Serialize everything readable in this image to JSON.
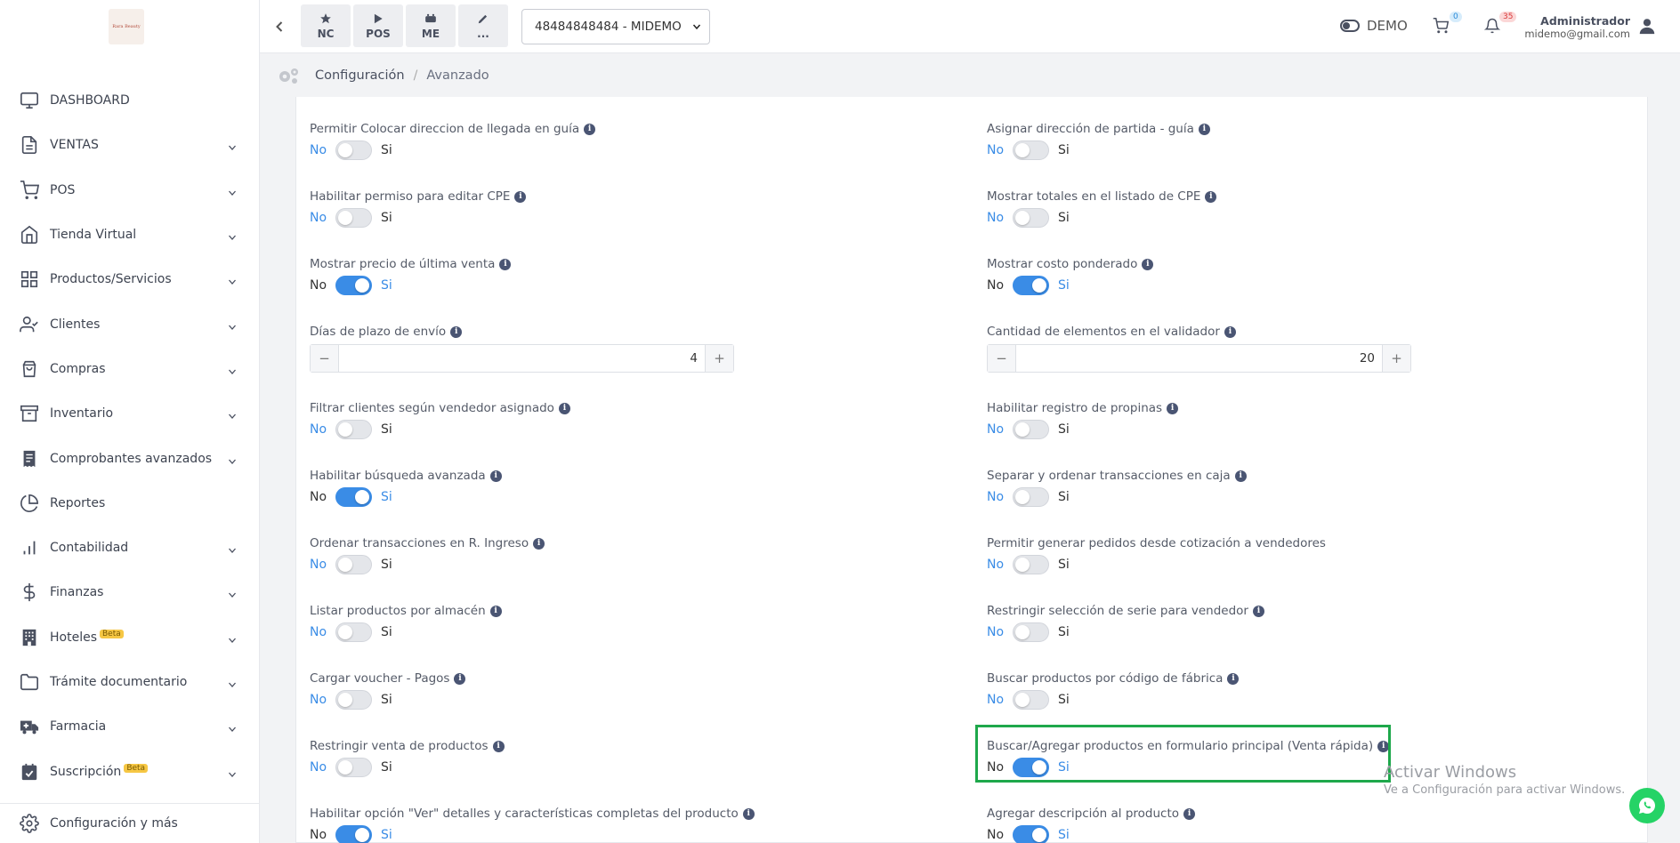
{
  "sidebar": {
    "logo_text": "Rara Beauty",
    "items": [
      {
        "label": "DASHBOARD",
        "icon": "monitor-icon",
        "chevron": false
      },
      {
        "label": "VENTAS",
        "icon": "document-icon",
        "chevron": true
      },
      {
        "label": "POS",
        "icon": "cart-icon",
        "chevron": true
      },
      {
        "label": "Tienda Virtual",
        "icon": "home-icon",
        "chevron": true
      },
      {
        "label": "Productos/Servicios",
        "icon": "grid-icon",
        "chevron": true
      },
      {
        "label": "Clientes",
        "icon": "user-check-icon",
        "chevron": true
      },
      {
        "label": "Compras",
        "icon": "bag-icon",
        "chevron": true
      },
      {
        "label": "Inventario",
        "icon": "archive-icon",
        "chevron": true
      },
      {
        "label": "Comprobantes avanzados",
        "icon": "receipt-icon",
        "chevron": true
      },
      {
        "label": "Reportes",
        "icon": "pie-chart-icon",
        "chevron": false
      },
      {
        "label": "Contabilidad",
        "icon": "bar-chart-icon",
        "chevron": true
      },
      {
        "label": "Finanzas",
        "icon": "dollar-icon",
        "chevron": true
      },
      {
        "label": "Hoteles",
        "icon": "building-icon",
        "chevron": true,
        "badge": "Beta"
      },
      {
        "label": "Trámite documentario",
        "icon": "folder-icon",
        "chevron": true
      },
      {
        "label": "Farmacia",
        "icon": "truck-medical-icon",
        "chevron": true
      },
      {
        "label": "Suscripción",
        "icon": "calendar-check-icon",
        "chevron": true,
        "badge": "Beta"
      }
    ],
    "footer_label": "Configuración y más"
  },
  "topbar": {
    "buttons": [
      {
        "label": "NC",
        "icon": "star-icon"
      },
      {
        "label": "POS",
        "icon": "play-icon"
      },
      {
        "label": "ME",
        "icon": "cash-icon"
      },
      {
        "label": "...",
        "icon": "pencil-icon"
      }
    ],
    "company_select": "48484848484 - MIDEMO",
    "demo_label": "DEMO",
    "cart_count": "0",
    "notification_count": "35",
    "user_name": "Administrador",
    "user_email": "midemo@gmail.com"
  },
  "breadcrumb": {
    "section": "Configuración",
    "separator": "/",
    "page": "Avanzado"
  },
  "toggle_labels": {
    "no": "No",
    "si": "Si"
  },
  "left_fields": [
    {
      "label": "Permitir Colocar direccion de llegada en guía",
      "type": "toggle",
      "on": false,
      "info": true
    },
    {
      "label": "Habilitar permiso para editar CPE",
      "type": "toggle",
      "on": false,
      "info": true
    },
    {
      "label": "Mostrar precio de última venta",
      "type": "toggle",
      "on": true,
      "info": true
    },
    {
      "label": "Días de plazo de envío",
      "type": "stepper",
      "value": "4",
      "info": true
    },
    {
      "label": "Filtrar clientes según vendedor asignado",
      "type": "toggle",
      "on": false,
      "info": true
    },
    {
      "label": "Habilitar búsqueda avanzada",
      "type": "toggle",
      "on": true,
      "info": true
    },
    {
      "label": "Ordenar transacciones en R. Ingreso",
      "type": "toggle",
      "on": false,
      "info": true
    },
    {
      "label": "Listar productos por almacén",
      "type": "toggle",
      "on": false,
      "info": true
    },
    {
      "label": "Cargar voucher - Pagos",
      "type": "toggle",
      "on": false,
      "info": true
    },
    {
      "label": "Restringir venta de productos",
      "type": "toggle",
      "on": false,
      "info": true
    },
    {
      "label": "Habilitar opción \"Ver\" detalles y características completas del producto",
      "type": "toggle",
      "on": true,
      "info": true
    }
  ],
  "right_fields": [
    {
      "label": "Asignar dirección de partida - guía",
      "type": "toggle",
      "on": false,
      "info": true
    },
    {
      "label": "Mostrar totales en el listado de CPE",
      "type": "toggle",
      "on": false,
      "info": true
    },
    {
      "label": "Mostrar costo ponderado",
      "type": "toggle",
      "on": true,
      "info": true
    },
    {
      "label": "Cantidad de elementos en el validador",
      "type": "stepper",
      "value": "20",
      "info": true
    },
    {
      "label": "Habilitar registro de propinas",
      "type": "toggle",
      "on": false,
      "info": true
    },
    {
      "label": "Separar y ordenar transacciones en caja",
      "type": "toggle",
      "on": false,
      "info": true
    },
    {
      "label": "Permitir generar pedidos desde cotización a vendedores",
      "type": "toggle",
      "on": false,
      "info": false
    },
    {
      "label": "Restringir selección de serie para vendedor",
      "type": "toggle",
      "on": false,
      "info": true
    },
    {
      "label": "Buscar productos por código de fábrica",
      "type": "toggle",
      "on": false,
      "info": true
    },
    {
      "label": "Buscar/Agregar productos en formulario principal (Venta rápida)",
      "type": "toggle",
      "on": true,
      "info": true
    },
    {
      "label": "Agregar descripción al producto",
      "type": "toggle",
      "on": true,
      "info": true
    }
  ],
  "watermark": {
    "title": "Activar Windows",
    "subtitle": "Ve a Configuración para activar Windows."
  },
  "colors": {
    "accent": "#3a8ce6",
    "highlight": "#1ea84b",
    "whatsapp": "#25d366"
  }
}
